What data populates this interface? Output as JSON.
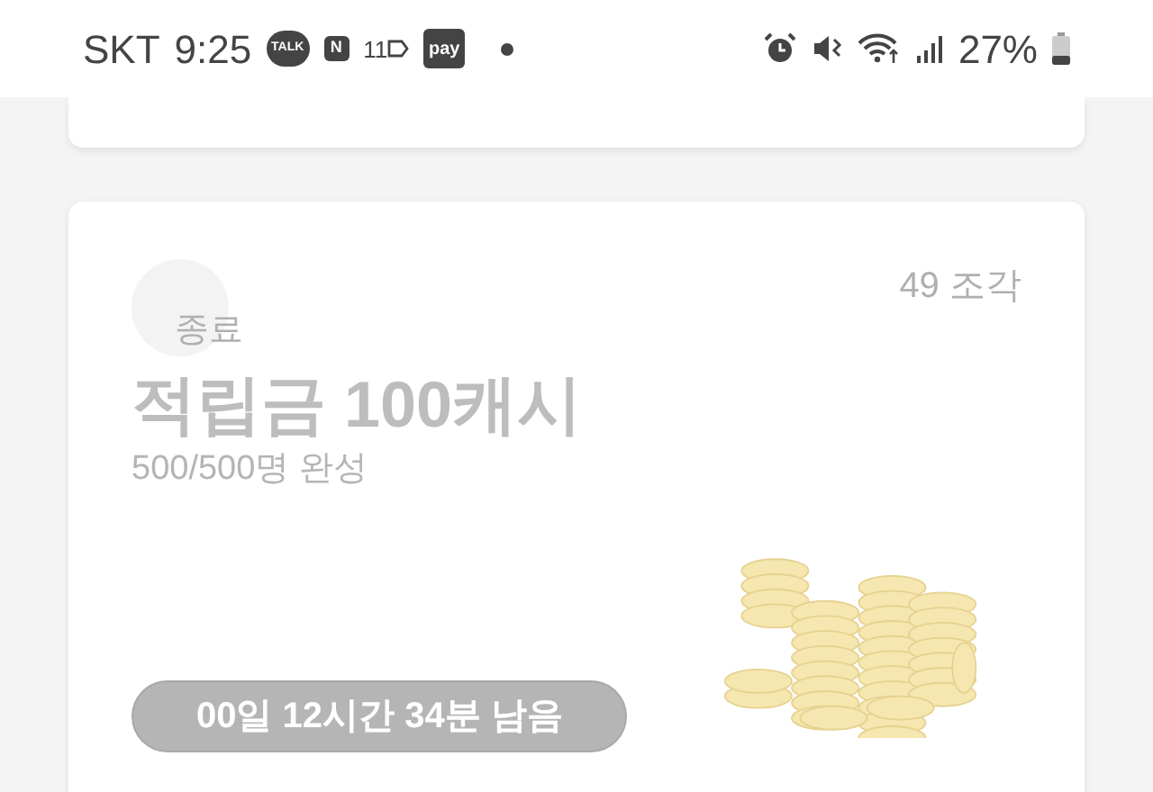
{
  "status_bar": {
    "carrier": "SKT",
    "time": "9:25",
    "notifications": [
      {
        "kind": "bubble",
        "label": "TALK"
      },
      {
        "kind": "square",
        "label": "N"
      },
      {
        "kind": "tag",
        "label": "11"
      },
      {
        "kind": "badge",
        "label": "pay"
      },
      {
        "kind": "dot"
      }
    ],
    "battery": "27%"
  },
  "card": {
    "status": "종료",
    "pieces": "49 조각",
    "title": "적립금 100캐시",
    "progress": "500/500명 완성",
    "remaining": "00일 12시간 34분 남음"
  }
}
